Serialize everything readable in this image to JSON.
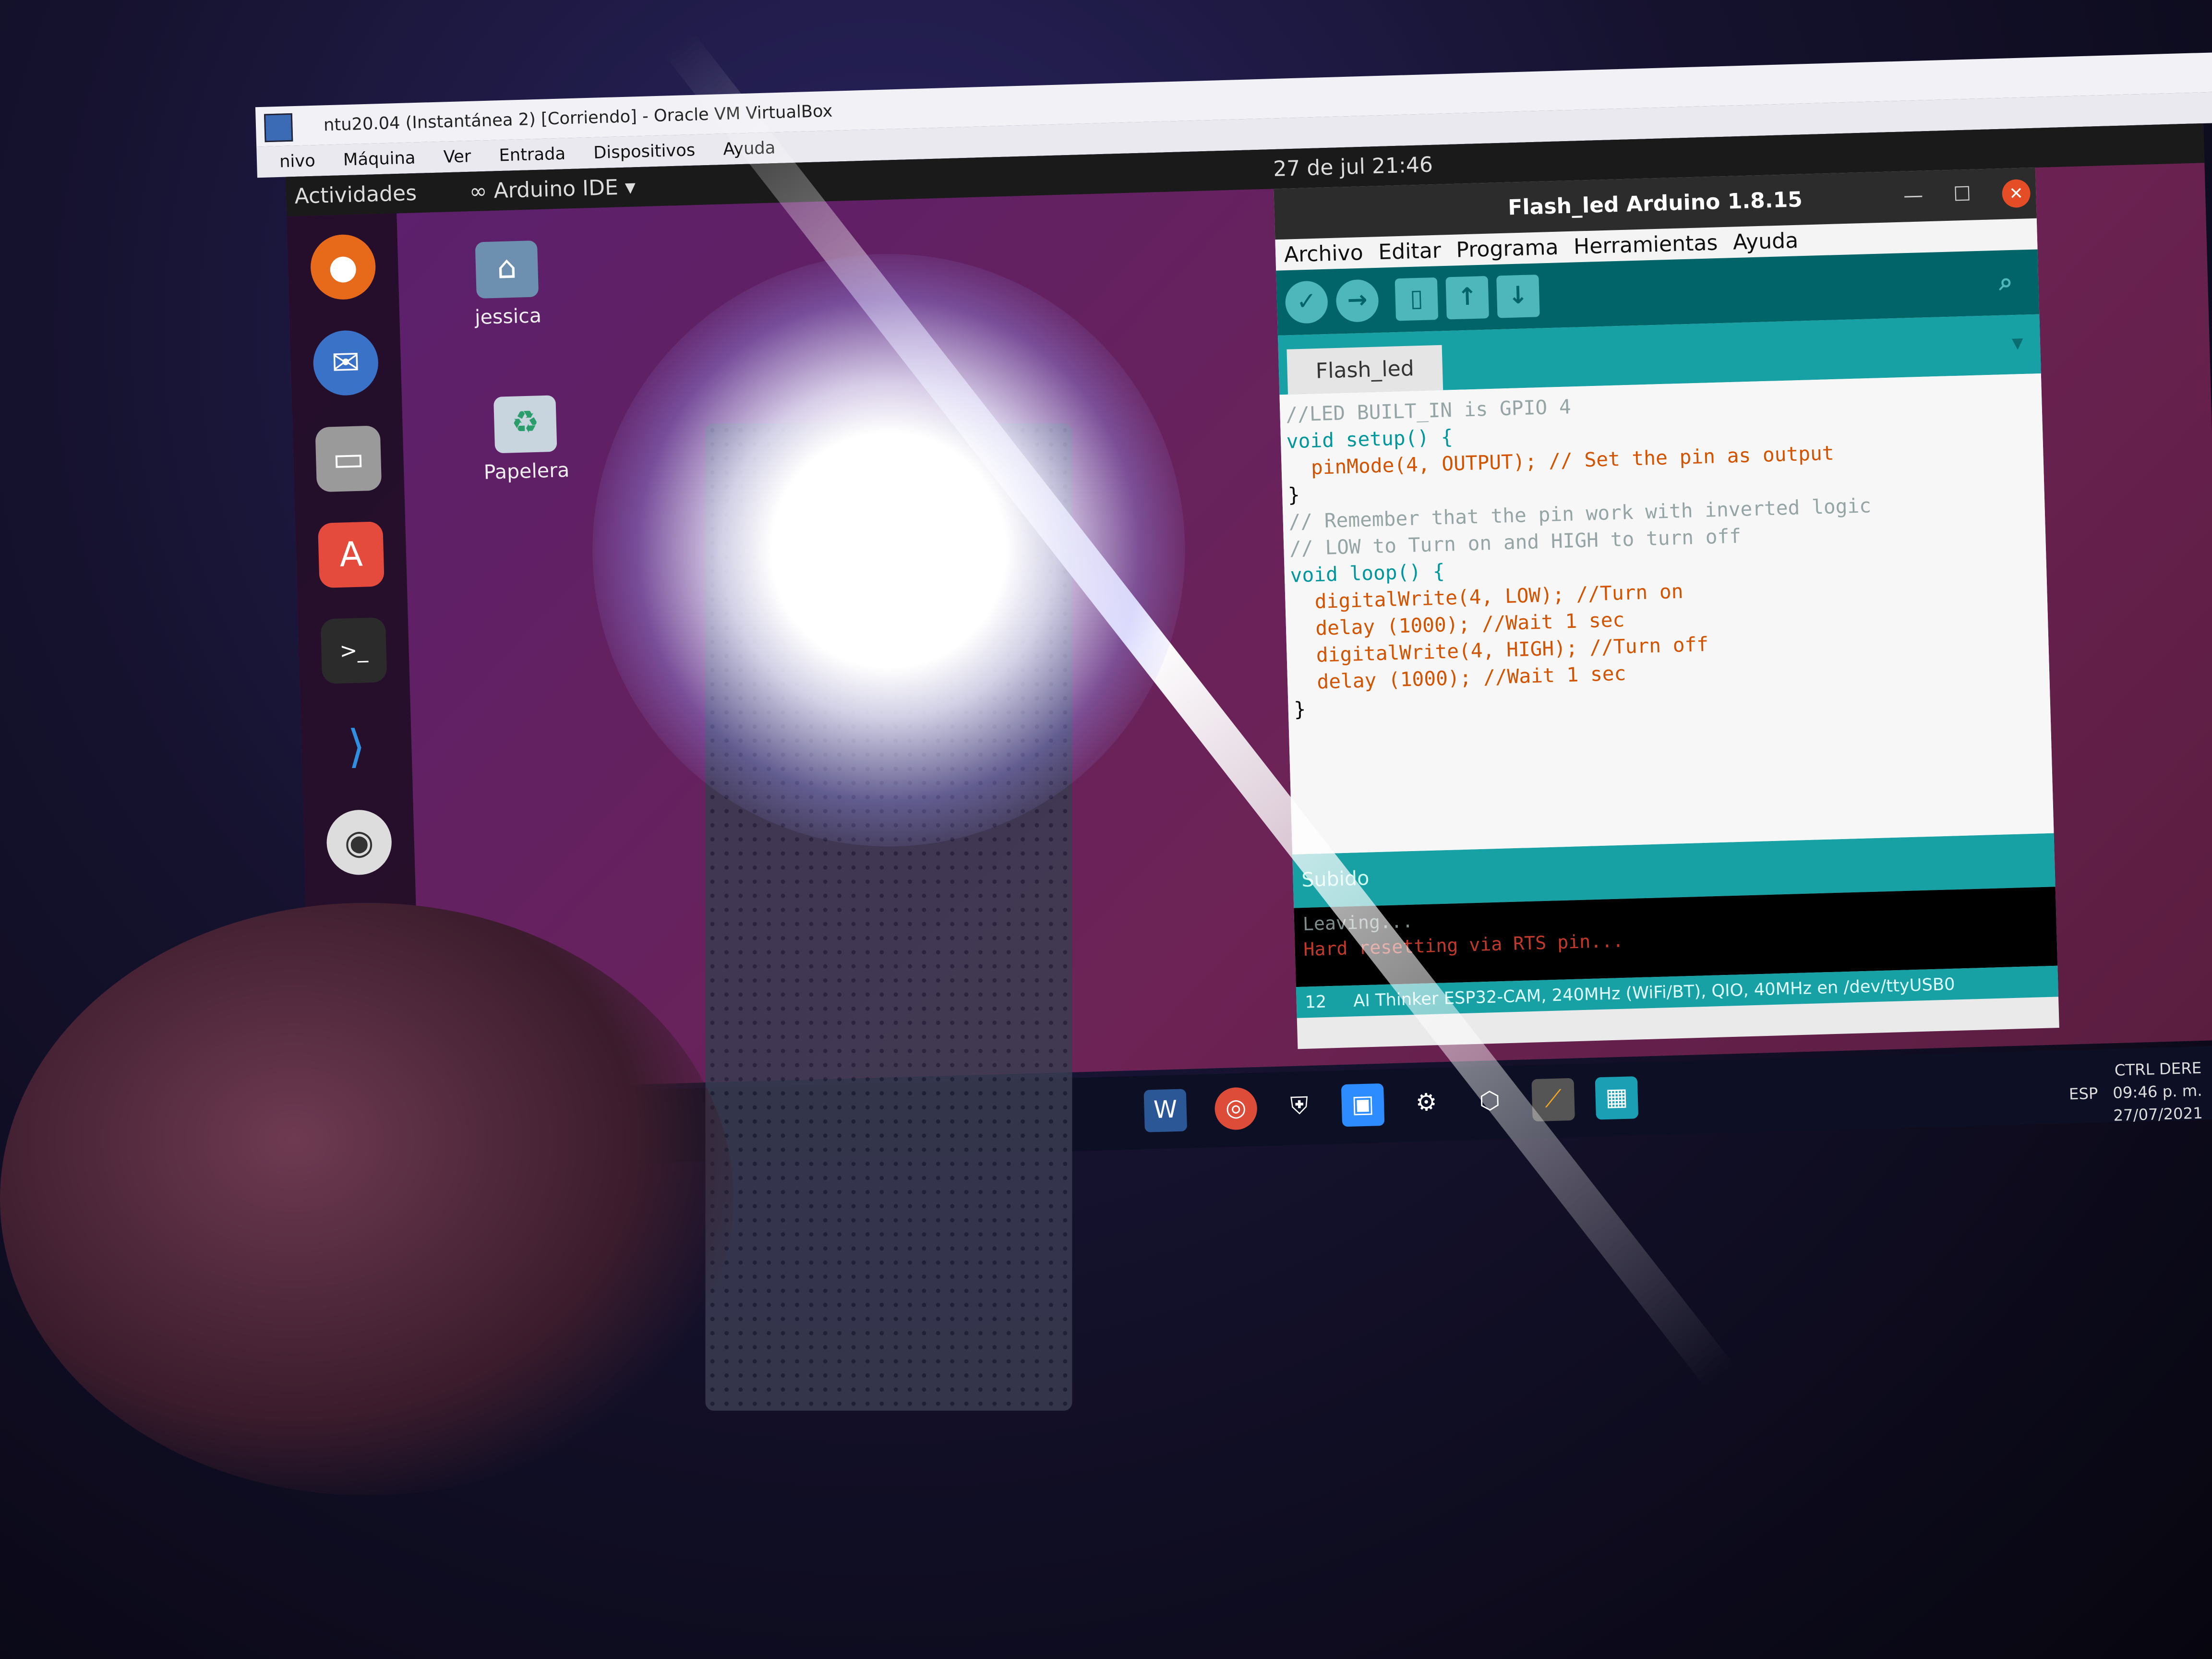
{
  "virtualbox": {
    "title": "ntu20.04 (Instantánea 2) [Corriendo] - Oracle VM VirtualBox",
    "menu": [
      "nivo",
      "Máquina",
      "Ver",
      "Entrada",
      "Dispositivos",
      "Ayuda"
    ]
  },
  "ubuntu": {
    "activities": "Actividades",
    "app_menu": "Arduino IDE",
    "clock": "27 de jul  21:46",
    "desktop_icons": [
      {
        "label": "jessica",
        "icon": "home-folder-icon"
      },
      {
        "label": "Papelera",
        "icon": "trash-icon"
      }
    ],
    "dock": [
      "firefox-icon",
      "thunderbird-icon",
      "files-icon",
      "software-center-icon",
      "terminal-icon",
      "vscode-icon",
      "github-desktop-icon",
      "app-icon"
    ]
  },
  "arduino": {
    "window_title": "Flash_led Arduino 1.8.15",
    "menu": [
      "Archivo",
      "Editar",
      "Programa",
      "Herramientas",
      "Ayuda"
    ],
    "toolbar": [
      "verify-icon",
      "upload-icon",
      "new-icon",
      "open-icon",
      "save-icon"
    ],
    "tab": "Flash_led",
    "code": [
      "//LED BUILT_IN is GPIO 4",
      "void setup() {",
      "  pinMode(4, OUTPUT); // Set the pin as output",
      "}",
      "// Remember that the pin work with inverted logic",
      "// LOW to Turn on and HIGH to turn off",
      "void loop() {",
      "  digitalWrite(4, LOW); //Turn on",
      "  delay (1000); //Wait 1 sec",
      "  digitalWrite(4, HIGH); //Turn off",
      "  delay (1000); //Wait 1 sec",
      "}"
    ],
    "status": "Subido",
    "console": [
      "Leaving...",
      "Hard resetting via RTS pin..."
    ],
    "line_number": "12",
    "board": "AI Thinker ESP32-CAM, 240MHz (WiFi/BT), QIO, 40MHz en /dev/ttyUSB0"
  },
  "windows": {
    "tray_lang": "ESP",
    "tray_time": "09:46 p. m.",
    "tray_date": "27/07/2021",
    "host_key": "CTRL DERE"
  }
}
